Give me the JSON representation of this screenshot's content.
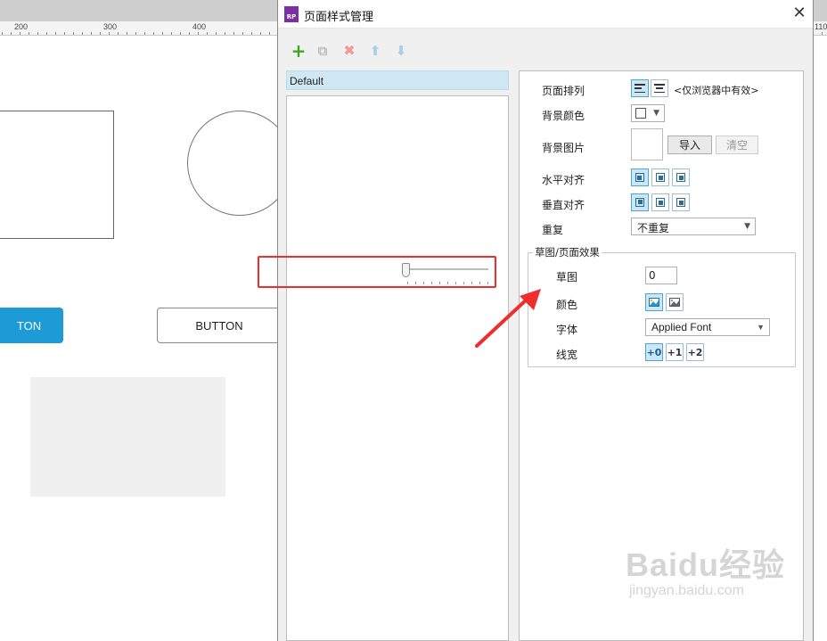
{
  "canvas": {
    "ruler_labels": [
      "200",
      "300",
      "400",
      "110"
    ],
    "button_primary": "TON",
    "button_secondary": "BUTTON"
  },
  "dialog": {
    "title": "页面样式管理",
    "app_icon_text": "RP",
    "toolbar": [
      "add-icon",
      "copy-icon",
      "delete-icon",
      "move-up-icon",
      "move-down-icon"
    ],
    "style_list": {
      "selected": "Default"
    },
    "properties": {
      "page_align_label": "页面排列",
      "page_align_note": "<仅浏览器中有效>",
      "bg_color_label": "背景颜色",
      "bg_image_label": "背景图片",
      "import_button": "导入",
      "clear_button": "清空",
      "h_align_label": "水平对齐",
      "v_align_label": "垂直对齐",
      "repeat_label": "重复",
      "repeat_value": "不重复",
      "sketch_group_title": "草图/页面效果",
      "sketch_label": "草图",
      "sketch_value": "0",
      "color_label": "颜色",
      "font_label": "字体",
      "font_value": "Applied Font",
      "line_width_label": "线宽",
      "line_width_options": [
        "+0",
        "+1",
        "+2"
      ]
    }
  },
  "watermark": {
    "text": "Baidu经验",
    "url": "jingyan.baidu.com"
  },
  "colors": {
    "accent": "#1c9bd7",
    "highlight": "#ef2d2d",
    "selected_row": "#cfe8f3"
  }
}
